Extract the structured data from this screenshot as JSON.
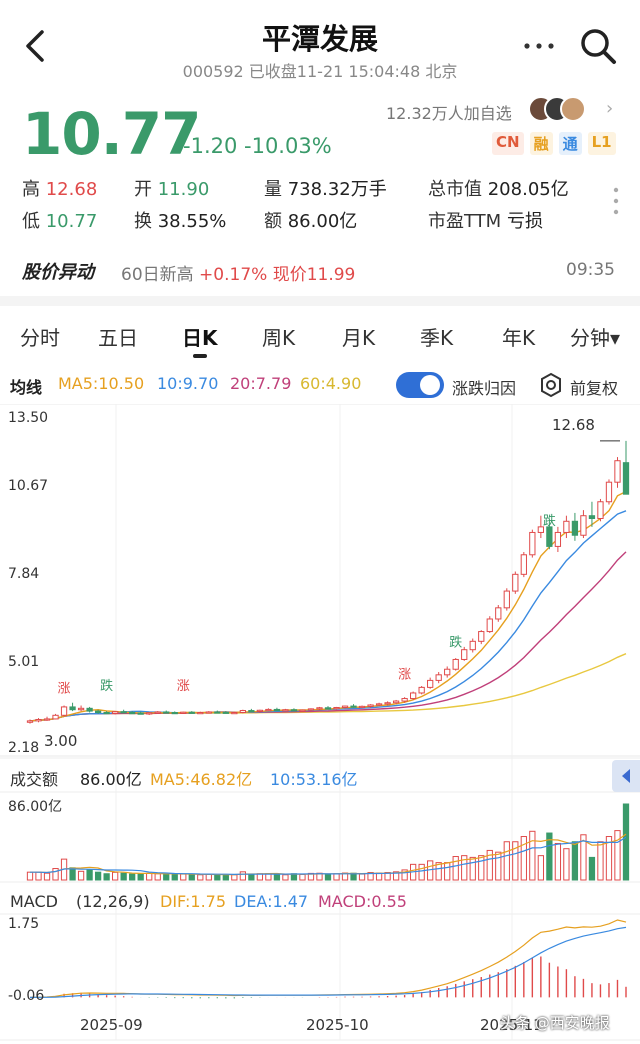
{
  "header": {
    "title": "平潭发展",
    "subtitle": "000592 已收盘11-21 15:04:48 北京"
  },
  "quote": {
    "price": "10.77",
    "change": "-1.20 -10.03%",
    "watchers": "12.32万人加自选",
    "badges": [
      "CN",
      "融",
      "通",
      "L1"
    ],
    "stats": {
      "high_label": "高",
      "high_value": "12.68",
      "open_label": "开",
      "open_value": "11.90",
      "volume_label": "量",
      "volume_value": "738.32万手",
      "mktcap_label": "总市值",
      "mktcap_value": "208.05亿",
      "low_label": "低",
      "low_value": "10.77",
      "turnover_label": "换",
      "turnover_value": "38.55%",
      "amount_label": "额",
      "amount_value": "86.00亿",
      "pe_label": "市盈TTM",
      "pe_value": "亏损"
    }
  },
  "alert": {
    "title": "股价异动",
    "text_prefix": "60日新高",
    "text_change": "+0.17% 现价11.99",
    "time": "09:35"
  },
  "tabs": [
    {
      "label": "分时"
    },
    {
      "label": "五日"
    },
    {
      "label": "日K",
      "active": true
    },
    {
      "label": "周K"
    },
    {
      "label": "月K"
    },
    {
      "label": "季K"
    },
    {
      "label": "年K"
    },
    {
      "label": "分钟▾"
    }
  ],
  "ma_legend": {
    "label": "均线",
    "ma5": "MA5:10.50",
    "ma10": "10:9.70",
    "ma20": "20:7.79",
    "ma60": "60:4.90",
    "toggle_label": "涨跌归因",
    "adjust_label": "前复权"
  },
  "price_axis": {
    "ticks": [
      "13.50",
      "10.67",
      "7.84",
      "5.01",
      "2.18"
    ],
    "max_marker": "12.68",
    "min_marker": "3.00"
  },
  "volume": {
    "label": "成交额",
    "value": "86.00亿",
    "ma5": "MA5:46.82亿",
    "ma10": "10:53.16亿",
    "axis_top": "86.00亿"
  },
  "macd": {
    "label": "MACD",
    "params": "(12,26,9)",
    "dif": "DIF:1.75",
    "dea": "DEA:1.47",
    "macd": "MACD:0.55",
    "axis_top": "1.75",
    "axis_bottom": "-0.06"
  },
  "x_axis": [
    "2025-09",
    "2025-10",
    "2025-11"
  ],
  "event_markers": [
    "涨",
    "跌"
  ],
  "watermark": "头条 @西安晚报",
  "colors": {
    "up": "#e04a4a",
    "down": "#3a9a6a",
    "ma5": "#e6a020",
    "ma10": "#3a8ae0",
    "ma20": "#c0407a",
    "ma60": "#e8c840",
    "accent": "#2f6fd6"
  },
  "chart_data": {
    "type": "candlestick",
    "candles": [
      [
        2.6,
        2.7,
        2.55,
        2.65
      ],
      [
        2.65,
        2.75,
        2.6,
        2.7
      ],
      [
        2.7,
        2.8,
        2.65,
        2.72
      ],
      [
        2.72,
        2.9,
        2.7,
        2.85
      ],
      [
        2.85,
        3.2,
        2.8,
        3.15
      ],
      [
        3.15,
        3.3,
        3.0,
        3.05
      ],
      [
        3.05,
        3.2,
        3.0,
        3.1
      ],
      [
        3.1,
        3.15,
        2.95,
        3.0
      ],
      [
        3.0,
        3.05,
        2.9,
        2.95
      ],
      [
        2.95,
        3.0,
        2.9,
        2.92
      ],
      [
        2.92,
        3.0,
        2.88,
        2.98
      ],
      [
        2.98,
        3.05,
        2.92,
        2.95
      ],
      [
        2.95,
        3.0,
        2.9,
        2.93
      ],
      [
        2.93,
        2.98,
        2.88,
        2.9
      ],
      [
        2.9,
        2.96,
        2.86,
        2.94
      ],
      [
        2.94,
        3.0,
        2.9,
        2.97
      ],
      [
        2.97,
        3.02,
        2.92,
        2.95
      ],
      [
        2.95,
        2.99,
        2.9,
        2.93
      ],
      [
        2.93,
        2.98,
        2.9,
        2.96
      ],
      [
        2.96,
        3.0,
        2.92,
        2.94
      ],
      [
        2.94,
        2.98,
        2.9,
        2.95
      ],
      [
        2.95,
        3.0,
        2.92,
        2.97
      ],
      [
        2.97,
        3.02,
        2.94,
        2.96
      ],
      [
        2.96,
        3.0,
        2.92,
        2.94
      ],
      [
        2.94,
        2.98,
        2.9,
        2.95
      ],
      [
        2.95,
        3.05,
        2.92,
        3.02
      ],
      [
        3.02,
        3.08,
        2.98,
        3.0
      ],
      [
        3.0,
        3.05,
        2.95,
        3.03
      ],
      [
        3.03,
        3.1,
        3.0,
        3.06
      ],
      [
        3.06,
        3.12,
        3.02,
        3.04
      ],
      [
        3.04,
        3.08,
        3.0,
        3.05
      ],
      [
        3.05,
        3.1,
        3.0,
        3.02
      ],
      [
        3.02,
        3.06,
        2.98,
        3.04
      ],
      [
        3.04,
        3.1,
        3.0,
        3.08
      ],
      [
        3.08,
        3.15,
        3.04,
        3.12
      ],
      [
        3.12,
        3.18,
        3.08,
        3.1
      ],
      [
        3.1,
        3.15,
        3.05,
        3.13
      ],
      [
        3.13,
        3.2,
        3.1,
        3.18
      ],
      [
        3.18,
        3.25,
        3.12,
        3.15
      ],
      [
        3.15,
        3.2,
        3.1,
        3.17
      ],
      [
        3.17,
        3.25,
        3.12,
        3.22
      ],
      [
        3.22,
        3.3,
        3.18,
        3.26
      ],
      [
        3.26,
        3.35,
        3.2,
        3.3
      ],
      [
        3.3,
        3.4,
        3.25,
        3.36
      ],
      [
        3.36,
        3.5,
        3.3,
        3.45
      ],
      [
        3.45,
        3.7,
        3.4,
        3.65
      ],
      [
        3.65,
        3.9,
        3.6,
        3.85
      ],
      [
        3.85,
        4.2,
        3.8,
        4.1
      ],
      [
        4.1,
        4.4,
        4.0,
        4.3
      ],
      [
        4.3,
        4.6,
        4.2,
        4.5
      ],
      [
        4.5,
        4.9,
        4.45,
        4.85
      ],
      [
        4.85,
        5.3,
        4.8,
        5.2
      ],
      [
        5.2,
        5.6,
        5.1,
        5.5
      ],
      [
        5.5,
        5.9,
        5.4,
        5.85
      ],
      [
        5.85,
        6.4,
        5.8,
        6.3
      ],
      [
        6.3,
        6.8,
        6.2,
        6.7
      ],
      [
        6.7,
        7.4,
        6.6,
        7.3
      ],
      [
        7.3,
        8.0,
        7.2,
        7.9
      ],
      [
        7.9,
        8.7,
        7.8,
        8.6
      ],
      [
        8.6,
        9.5,
        8.5,
        9.4
      ],
      [
        9.4,
        10.0,
        9.2,
        9.6
      ],
      [
        9.6,
        9.9,
        8.8,
        8.9
      ],
      [
        8.9,
        9.6,
        8.7,
        9.4
      ],
      [
        9.4,
        10.0,
        9.2,
        9.8
      ],
      [
        9.8,
        10.1,
        9.1,
        9.3
      ],
      [
        9.3,
        10.2,
        9.2,
        10.0
      ],
      [
        10.0,
        10.5,
        9.6,
        9.9
      ],
      [
        9.9,
        10.6,
        9.8,
        10.5
      ],
      [
        10.5,
        11.3,
        10.4,
        11.2
      ],
      [
        11.2,
        12.1,
        11.0,
        11.97
      ],
      [
        11.9,
        12.68,
        10.77,
        10.77
      ]
    ]
  }
}
